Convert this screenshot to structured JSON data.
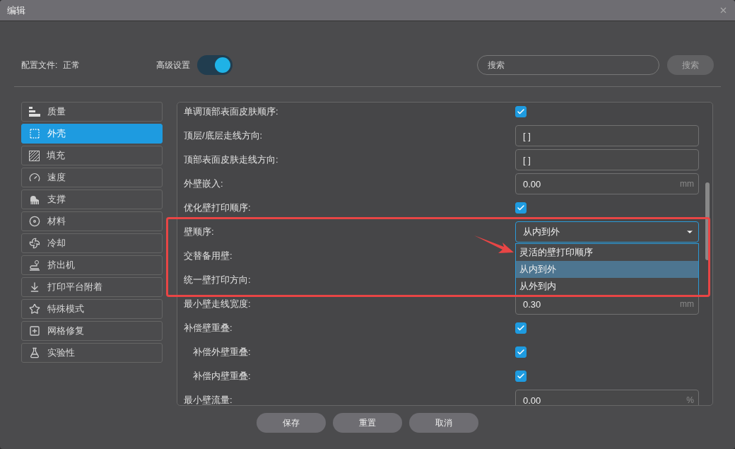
{
  "window": {
    "title": "编辑"
  },
  "profile": {
    "label": "配置文件:",
    "value": "正常"
  },
  "advanced": {
    "label": "高级设置",
    "on": true
  },
  "search": {
    "placeholder": "搜索",
    "button": "搜索"
  },
  "sidebar": {
    "items": [
      {
        "label": "质量",
        "selected": false
      },
      {
        "label": "外壳",
        "selected": true
      },
      {
        "label": "填充",
        "selected": false
      },
      {
        "label": "速度",
        "selected": false
      },
      {
        "label": "支撑",
        "selected": false
      },
      {
        "label": "材料",
        "selected": false
      },
      {
        "label": "冷却",
        "selected": false
      },
      {
        "label": "挤出机",
        "selected": false
      },
      {
        "label": "打印平台附着",
        "selected": false
      },
      {
        "label": "特殊模式",
        "selected": false
      },
      {
        "label": "网格修复",
        "selected": false
      },
      {
        "label": "实验性",
        "selected": false
      }
    ]
  },
  "settings": [
    {
      "label": "单调顶部表面皮肤顺序:",
      "kind": "checkbox",
      "checked": true
    },
    {
      "label": "顶层/底层走线方向:",
      "kind": "text",
      "value": "[ ]"
    },
    {
      "label": "顶部表面皮肤走线方向:",
      "kind": "text",
      "value": "[ ]"
    },
    {
      "label": "外壁嵌入:",
      "kind": "number",
      "value": "0.00",
      "unit": "mm"
    },
    {
      "label": "优化壁打印顺序:",
      "kind": "checkbox",
      "checked": true
    },
    {
      "label": "壁顺序:",
      "kind": "select",
      "value": "从内到外",
      "expanded": true,
      "options": [
        {
          "label": "灵活的壁打印顺序",
          "selected": false
        },
        {
          "label": "从内到外",
          "selected": true
        },
        {
          "label": "从外到内",
          "selected": false
        }
      ]
    },
    {
      "label": "交替备用壁:",
      "kind": "plain"
    },
    {
      "label": "统一壁打印方向:",
      "kind": "plain"
    },
    {
      "label": "最小壁走线宽度:",
      "kind": "number",
      "value": "0.30",
      "unit": "mm"
    },
    {
      "label": "补偿壁重叠:",
      "kind": "checkbox",
      "checked": true,
      "children": [
        {
          "label": "补偿外壁重叠:",
          "kind": "checkbox",
          "checked": true
        },
        {
          "label": "补偿内壁重叠:",
          "kind": "checkbox",
          "checked": true
        }
      ]
    },
    {
      "label": "最小壁流量:",
      "kind": "number",
      "value": "0.00",
      "unit": "%"
    }
  ],
  "buttons": [
    "保存",
    "重置",
    "取消"
  ]
}
